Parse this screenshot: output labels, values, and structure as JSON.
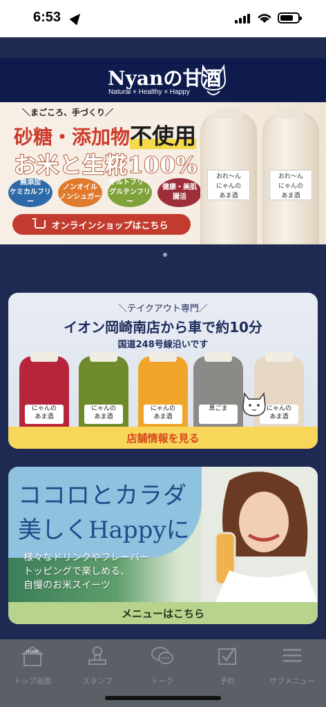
{
  "status_bar": {
    "time": "6:53"
  },
  "header": {
    "logo_title": "Nyanの甘酒",
    "logo_subtitle": "Natural × Healthy × Happy"
  },
  "hero": {
    "tag": "＼まごころ、手づくり／",
    "headline_red": "砂糖・添加物",
    "headline_highlight": "不使用",
    "headline2": "お米と生糀100%",
    "badges": [
      {
        "text": "無添加\nケミカルフリー",
        "color": "#2e6aa8"
      },
      {
        "text": "ノンオイル\nノンシュガー",
        "color": "#e07a2c"
      },
      {
        "text": "ギルトフリー\nグルテンフリー",
        "color": "#7fa23a"
      },
      {
        "text": "健康・美肌\n腸活",
        "color": "#9e2f3a"
      }
    ],
    "shop_button": "オンラインショップはこちら",
    "bottle_label": "おれ〜ん\nにゃんの\nあま酒"
  },
  "card_takeout": {
    "top": "＼テイクアウト専門／",
    "title": "イオン岡崎南店から車で約10分",
    "subtitle": "国道248号線沿いです",
    "button": "店舗情報を見る",
    "jars": [
      {
        "color": "#b8243a",
        "label": "にゃんの\nあま酒"
      },
      {
        "color": "#6f8a2a",
        "label": "にゃんの\nあま酒"
      },
      {
        "color": "#f0a52a",
        "label": "にゃんの\nあま酒"
      },
      {
        "color": "#8a8a86",
        "label": "黒ごま"
      },
      {
        "color": "#e7d7c5",
        "label": "にゃんの\nあま酒"
      }
    ]
  },
  "card_menu": {
    "headline1": "ココロとカラダ",
    "headline2": "美しくHappyに",
    "text": "様々なドリンクやフレーバー\nトッピングで楽しめる、\n自慢のお米スイーツ",
    "button": "メニューはこちら"
  },
  "tabbar": {
    "items": [
      {
        "label": "トップ画面",
        "icon": "home-icon",
        "icon_text": "HOME"
      },
      {
        "label": "スタンプ",
        "icon": "stamp-icon"
      },
      {
        "label": "トーク",
        "icon": "chat-icon"
      },
      {
        "label": "予約",
        "icon": "calendar-check-icon"
      },
      {
        "label": "サブメニュー",
        "icon": "hamburger-icon"
      }
    ]
  }
}
